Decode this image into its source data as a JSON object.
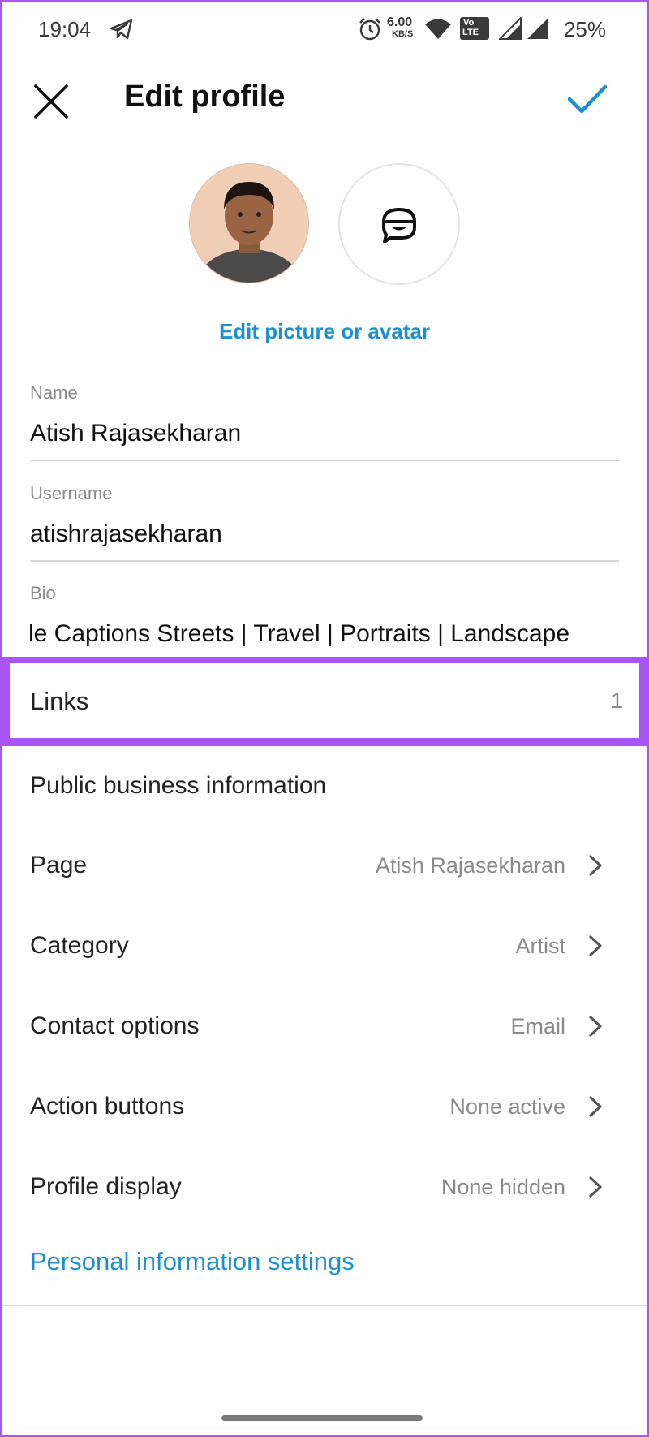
{
  "status_bar": {
    "time": "19:04",
    "net_speed_value": "6.00",
    "net_speed_unit": "KB/S",
    "volte_top": "Vo",
    "volte_mid": "LTE",
    "battery": "25%"
  },
  "header": {
    "close_icon": "close-icon",
    "title": "Edit profile",
    "confirm_icon": "checkmark-icon",
    "accent": "#1d8fd1"
  },
  "avatar": {
    "edit_label": "Edit picture or avatar"
  },
  "fields": {
    "name_label": "Name",
    "name_value": "Atish Rajasekharan",
    "username_label": "Username",
    "username_value": "atishrajasekharan",
    "bio_label": "Bio",
    "bio_value": "le Captions Streets | Travel | Portraits | Landscape"
  },
  "links": {
    "label": "Links",
    "count": "1"
  },
  "business": {
    "heading": "Public business information",
    "rows": [
      {
        "label": "Page",
        "value": "Atish Rajasekharan"
      },
      {
        "label": "Category",
        "value": "Artist"
      },
      {
        "label": "Contact options",
        "value": "Email"
      },
      {
        "label": "Action buttons",
        "value": "None active"
      },
      {
        "label": "Profile display",
        "value": "None hidden"
      }
    ]
  },
  "personal_settings": "Personal information settings",
  "highlight_color": "#a855f7"
}
